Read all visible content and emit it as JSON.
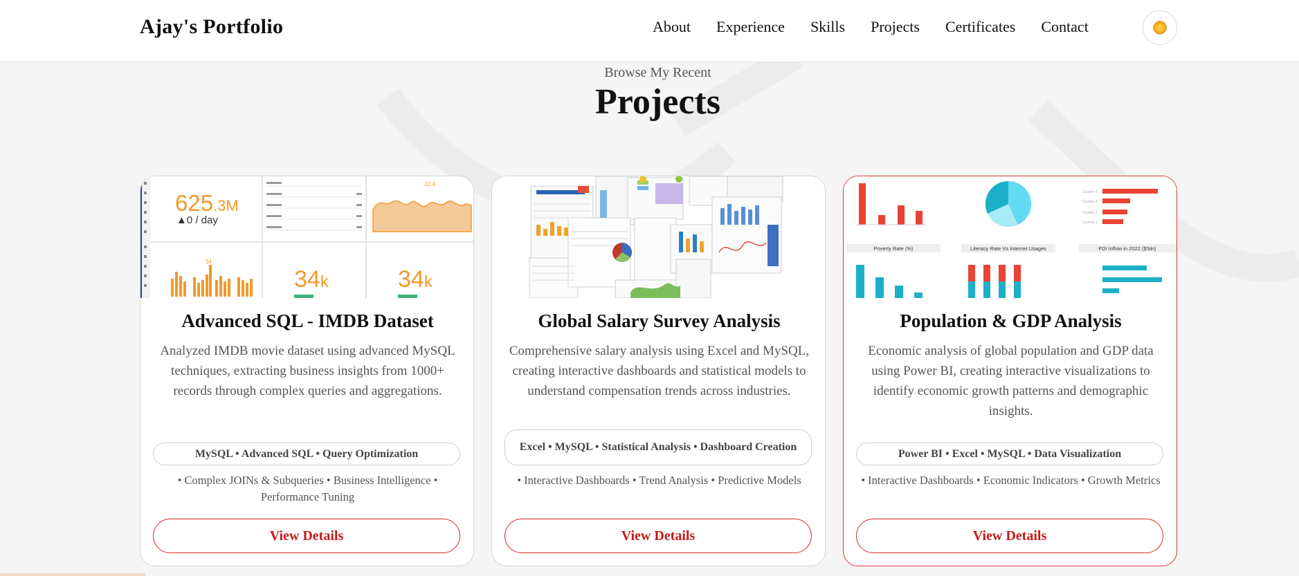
{
  "navbar": {
    "brand": "Ajay's Portfolio",
    "links": [
      "About",
      "Experience",
      "Skills",
      "Projects",
      "Certificates",
      "Contact"
    ],
    "theme_icon": "sun-icon"
  },
  "section": {
    "subtitle": "Browse My Recent",
    "title": "Projects"
  },
  "projects": [
    {
      "title": "Advanced SQL - IMDB Dataset",
      "description": "Analyzed IMDB movie dataset using advanced MySQL techniques, extracting business insights from 1000+ records through complex queries and aggregations.",
      "tags": "MySQL • Advanced SQL • Query Optimization",
      "features": "• Complex JOINs & Subqueries • Business Intelligence • Performance Tuning",
      "button": "View Details",
      "thumb": {
        "big_value": "625",
        "big_suffix": ".3M",
        "rate": "▲0 / day",
        "stat1": "34",
        "stat1_suffix": "k",
        "stat2": "34",
        "stat2_suffix": "k"
      }
    },
    {
      "title": "Global Salary Survey Analysis",
      "description": "Comprehensive salary analysis using Excel and MySQL, creating interactive dashboards and statistical models to understand compensation trends across industries.",
      "tags": "Excel • MySQL • Statistical Analysis • Dashboard Creation",
      "features": "• Interactive Dashboards • Trend Analysis • Predictive Models",
      "button": "View Details"
    },
    {
      "title": "Population & GDP Analysis",
      "description": "Economic analysis of global population and GDP data using Power BI, creating interactive visualizations to identify economic growth patterns and demographic insights.",
      "tags": "Power BI • Excel • MySQL • Data Visualization",
      "features": "• Interactive Dashboards • Economic Indicators • Growth Metrics",
      "button": "View Details",
      "thumb": {
        "panel1": "Poverty Rate (%)",
        "panel2": "Literacy Rate Vs Internet Usages",
        "panel3": "FDI Inflow in 2022 ($'bln)"
      }
    }
  ],
  "colors": {
    "accent": "#d42a2a",
    "background": "#f5f5f5",
    "orange": "#f09a2a",
    "teal": "#1cb0c8",
    "red_bar": "#e84335"
  }
}
